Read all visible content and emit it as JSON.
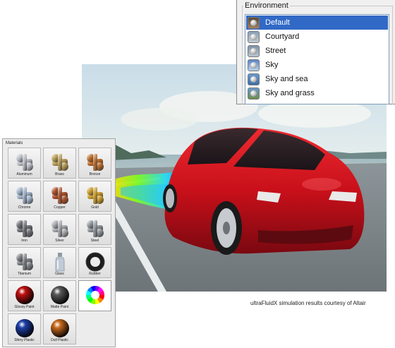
{
  "environment": {
    "title": "Environment",
    "items": [
      {
        "label": "Default",
        "selected": true,
        "icon": "env-default-thumbnail"
      },
      {
        "label": "Courtyard",
        "selected": false,
        "icon": "env-courtyard-thumbnail"
      },
      {
        "label": "Street",
        "selected": false,
        "icon": "env-street-thumbnail"
      },
      {
        "label": "Sky",
        "selected": false,
        "icon": "env-sky-thumbnail"
      },
      {
        "label": "Sky and sea",
        "selected": false,
        "icon": "env-sky-sea-thumbnail"
      },
      {
        "label": "Sky and grass",
        "selected": false,
        "icon": "env-sky-grass-thumbnail"
      }
    ],
    "selection_color": "#3169c6"
  },
  "materials": {
    "title": "Materials",
    "items": [
      {
        "label": "Aluminum",
        "kind": "joint",
        "color": "#b8bcc4"
      },
      {
        "label": "Brass",
        "kind": "joint",
        "color": "#b59a55"
      },
      {
        "label": "Bronze",
        "kind": "joint",
        "color": "#b86a2a"
      },
      {
        "label": "Chrome",
        "kind": "joint",
        "color": "#9fb0c8"
      },
      {
        "label": "Copper",
        "kind": "joint",
        "color": "#a8502a"
      },
      {
        "label": "Gold",
        "kind": "joint",
        "color": "#c89a2a"
      },
      {
        "label": "Iron",
        "kind": "joint",
        "color": "#6d6f73"
      },
      {
        "label": "Silver",
        "kind": "joint",
        "color": "#a6a9ae"
      },
      {
        "label": "Steel",
        "kind": "joint",
        "color": "#8e949a"
      },
      {
        "label": "Titanium",
        "kind": "joint",
        "color": "#7b7e82"
      },
      {
        "label": "Glass",
        "kind": "bottle",
        "color": "#b9c6d4"
      },
      {
        "label": "Rubber",
        "kind": "tire",
        "color": "#1e1e1e"
      },
      {
        "label": "Glossy Paint",
        "kind": "sphere",
        "color": "#c01010"
      },
      {
        "label": "Matte Paint",
        "kind": "sphere",
        "color": "#5a5a5a"
      },
      {
        "label": "",
        "kind": "color-wheel",
        "color": "#ffffff"
      },
      {
        "label": "Shiny Plastic",
        "kind": "sphere",
        "color": "#1e3fa8"
      },
      {
        "label": "Dull Plastic",
        "kind": "sphere",
        "color": "#c86a1e"
      }
    ]
  },
  "render": {
    "caption": "ultraFluidX simulation results courtesy of Altair",
    "car_color": "#c8101a"
  }
}
